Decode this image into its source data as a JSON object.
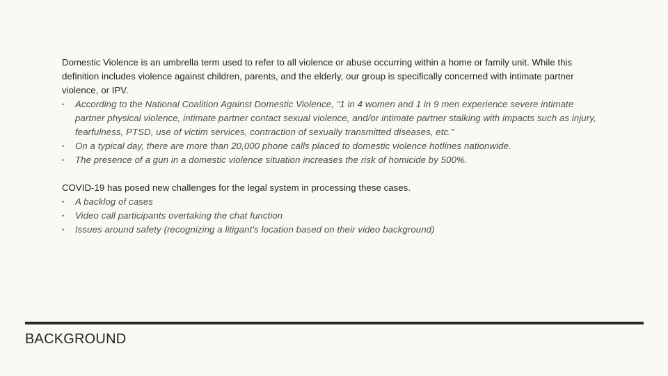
{
  "intro": {
    "heading": "Domestic Violence is an umbrella term used to refer to all violence or abuse occurring within a home or family unit. While this definition includes violence against children, parents, and the elderly, our group is specifically concerned with intimate partner violence, or IPV.",
    "bullets": [
      "According to the National Coalition Against Domestic Violence, “1 in 4 women and 1 in 9 men experience severe intimate partner physical violence, intimate partner contact sexual violence, and/or intimate partner stalking with impacts such as injury, fearfulness, PTSD, use of victim services, contraction of sexually transmitted diseases, etc.”",
      "On a typical day, there are more than 20,000 phone calls placed to domestic violence hotlines nationwide.",
      "The presence of a gun in a domestic violence situation increases the risk of homicide by 500%."
    ]
  },
  "covid": {
    "heading": "COVID-19 has posed new challenges for the legal system in processing these cases.",
    "bullets": [
      "A backlog of cases",
      "Video call participants overtaking the chat function",
      "Issues around safety (recognizing a litigant’s location based on their video background)"
    ]
  },
  "bullet_symbol": "•",
  "slide_title": "BACKGROUND",
  "colors": {
    "background": "#fbf9f4",
    "rule": "#2a2a2a",
    "body_text": "#1e1e1e",
    "bullet_text": "#4a4a4a"
  }
}
